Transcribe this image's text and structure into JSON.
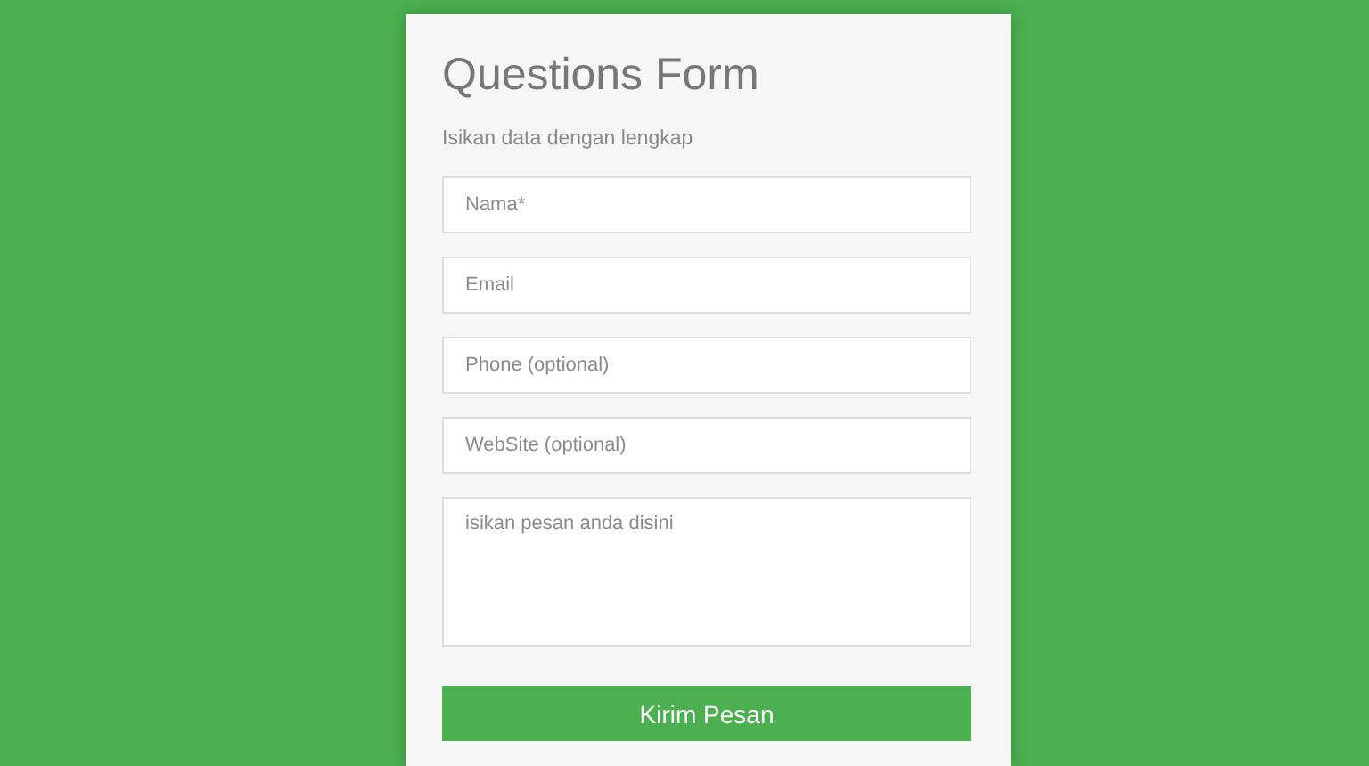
{
  "form": {
    "title": "Questions Form",
    "subtitle": "Isikan data dengan lengkap",
    "fields": [
      {
        "kind": "input",
        "placeholder": "Nama*"
      },
      {
        "kind": "input",
        "placeholder": "Email"
      },
      {
        "kind": "input",
        "placeholder": "Phone (optional)"
      },
      {
        "kind": "input",
        "placeholder": "WebSite (optional)"
      },
      {
        "kind": "textarea",
        "placeholder": "isikan pesan anda disini"
      }
    ],
    "submit": "Kirim Pesan"
  }
}
